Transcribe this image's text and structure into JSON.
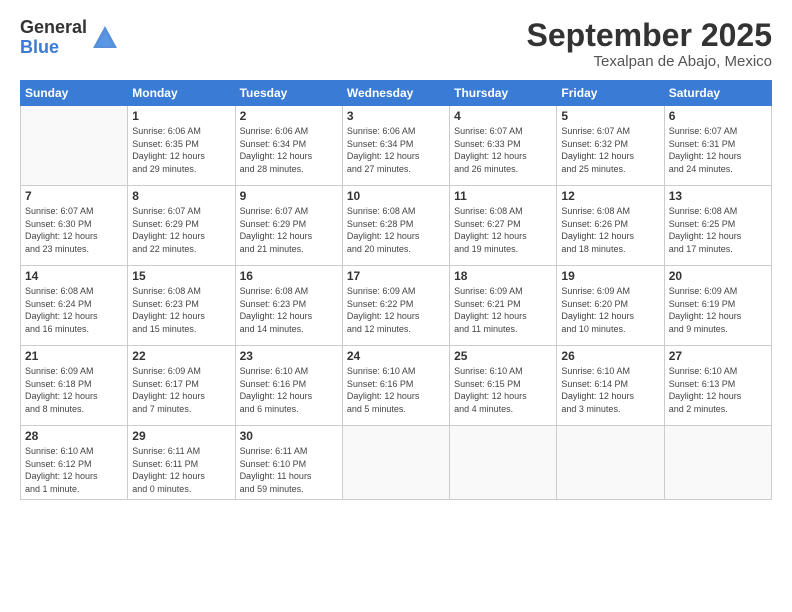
{
  "logo": {
    "general": "General",
    "blue": "Blue"
  },
  "title": {
    "month": "September 2025",
    "location": "Texalpan de Abajo, Mexico"
  },
  "days_of_week": [
    "Sunday",
    "Monday",
    "Tuesday",
    "Wednesday",
    "Thursday",
    "Friday",
    "Saturday"
  ],
  "weeks": [
    [
      {
        "day": "",
        "info": ""
      },
      {
        "day": "1",
        "info": "Sunrise: 6:06 AM\nSunset: 6:35 PM\nDaylight: 12 hours\nand 29 minutes."
      },
      {
        "day": "2",
        "info": "Sunrise: 6:06 AM\nSunset: 6:34 PM\nDaylight: 12 hours\nand 28 minutes."
      },
      {
        "day": "3",
        "info": "Sunrise: 6:06 AM\nSunset: 6:34 PM\nDaylight: 12 hours\nand 27 minutes."
      },
      {
        "day": "4",
        "info": "Sunrise: 6:07 AM\nSunset: 6:33 PM\nDaylight: 12 hours\nand 26 minutes."
      },
      {
        "day": "5",
        "info": "Sunrise: 6:07 AM\nSunset: 6:32 PM\nDaylight: 12 hours\nand 25 minutes."
      },
      {
        "day": "6",
        "info": "Sunrise: 6:07 AM\nSunset: 6:31 PM\nDaylight: 12 hours\nand 24 minutes."
      }
    ],
    [
      {
        "day": "7",
        "info": "Sunrise: 6:07 AM\nSunset: 6:30 PM\nDaylight: 12 hours\nand 23 minutes."
      },
      {
        "day": "8",
        "info": "Sunrise: 6:07 AM\nSunset: 6:29 PM\nDaylight: 12 hours\nand 22 minutes."
      },
      {
        "day": "9",
        "info": "Sunrise: 6:07 AM\nSunset: 6:29 PM\nDaylight: 12 hours\nand 21 minutes."
      },
      {
        "day": "10",
        "info": "Sunrise: 6:08 AM\nSunset: 6:28 PM\nDaylight: 12 hours\nand 20 minutes."
      },
      {
        "day": "11",
        "info": "Sunrise: 6:08 AM\nSunset: 6:27 PM\nDaylight: 12 hours\nand 19 minutes."
      },
      {
        "day": "12",
        "info": "Sunrise: 6:08 AM\nSunset: 6:26 PM\nDaylight: 12 hours\nand 18 minutes."
      },
      {
        "day": "13",
        "info": "Sunrise: 6:08 AM\nSunset: 6:25 PM\nDaylight: 12 hours\nand 17 minutes."
      }
    ],
    [
      {
        "day": "14",
        "info": "Sunrise: 6:08 AM\nSunset: 6:24 PM\nDaylight: 12 hours\nand 16 minutes."
      },
      {
        "day": "15",
        "info": "Sunrise: 6:08 AM\nSunset: 6:23 PM\nDaylight: 12 hours\nand 15 minutes."
      },
      {
        "day": "16",
        "info": "Sunrise: 6:08 AM\nSunset: 6:23 PM\nDaylight: 12 hours\nand 14 minutes."
      },
      {
        "day": "17",
        "info": "Sunrise: 6:09 AM\nSunset: 6:22 PM\nDaylight: 12 hours\nand 12 minutes."
      },
      {
        "day": "18",
        "info": "Sunrise: 6:09 AM\nSunset: 6:21 PM\nDaylight: 12 hours\nand 11 minutes."
      },
      {
        "day": "19",
        "info": "Sunrise: 6:09 AM\nSunset: 6:20 PM\nDaylight: 12 hours\nand 10 minutes."
      },
      {
        "day": "20",
        "info": "Sunrise: 6:09 AM\nSunset: 6:19 PM\nDaylight: 12 hours\nand 9 minutes."
      }
    ],
    [
      {
        "day": "21",
        "info": "Sunrise: 6:09 AM\nSunset: 6:18 PM\nDaylight: 12 hours\nand 8 minutes."
      },
      {
        "day": "22",
        "info": "Sunrise: 6:09 AM\nSunset: 6:17 PM\nDaylight: 12 hours\nand 7 minutes."
      },
      {
        "day": "23",
        "info": "Sunrise: 6:10 AM\nSunset: 6:16 PM\nDaylight: 12 hours\nand 6 minutes."
      },
      {
        "day": "24",
        "info": "Sunrise: 6:10 AM\nSunset: 6:16 PM\nDaylight: 12 hours\nand 5 minutes."
      },
      {
        "day": "25",
        "info": "Sunrise: 6:10 AM\nSunset: 6:15 PM\nDaylight: 12 hours\nand 4 minutes."
      },
      {
        "day": "26",
        "info": "Sunrise: 6:10 AM\nSunset: 6:14 PM\nDaylight: 12 hours\nand 3 minutes."
      },
      {
        "day": "27",
        "info": "Sunrise: 6:10 AM\nSunset: 6:13 PM\nDaylight: 12 hours\nand 2 minutes."
      }
    ],
    [
      {
        "day": "28",
        "info": "Sunrise: 6:10 AM\nSunset: 6:12 PM\nDaylight: 12 hours\nand 1 minute."
      },
      {
        "day": "29",
        "info": "Sunrise: 6:11 AM\nSunset: 6:11 PM\nDaylight: 12 hours\nand 0 minutes."
      },
      {
        "day": "30",
        "info": "Sunrise: 6:11 AM\nSunset: 6:10 PM\nDaylight: 11 hours\nand 59 minutes."
      },
      {
        "day": "",
        "info": ""
      },
      {
        "day": "",
        "info": ""
      },
      {
        "day": "",
        "info": ""
      },
      {
        "day": "",
        "info": ""
      }
    ]
  ]
}
